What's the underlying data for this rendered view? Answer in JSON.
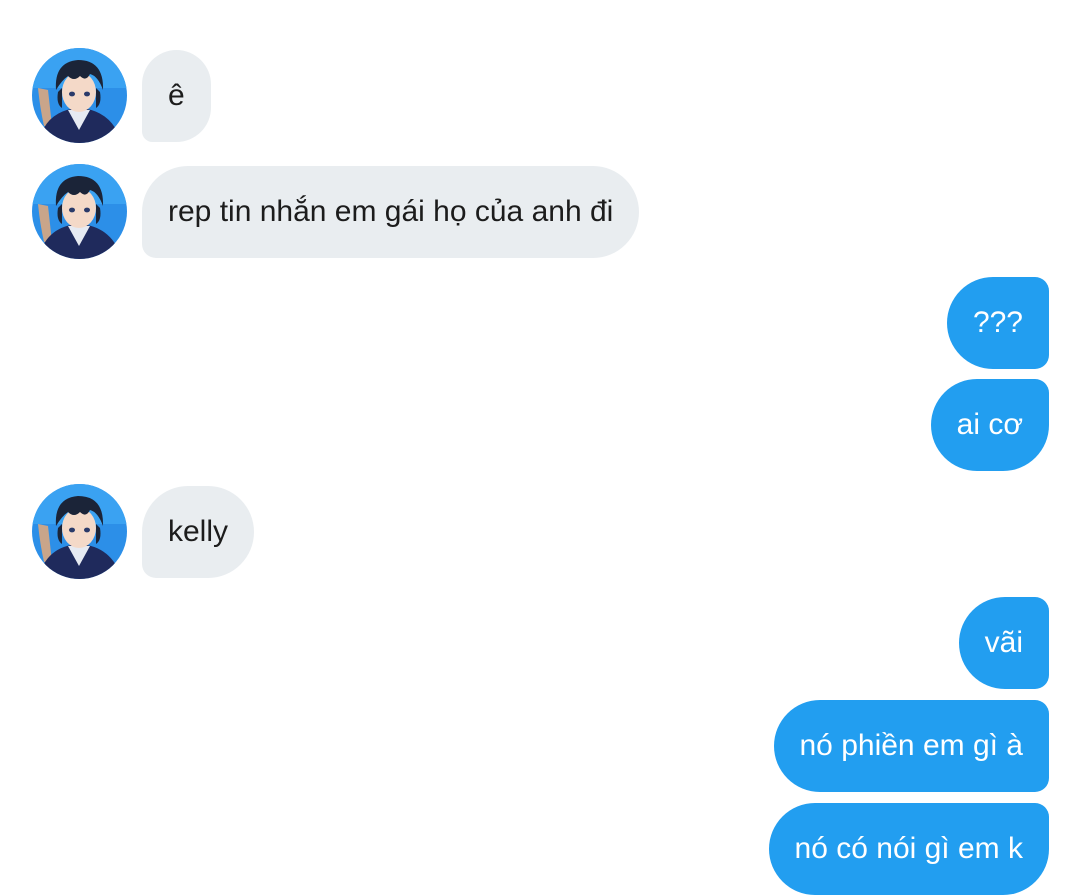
{
  "messages": [
    {
      "side": "in",
      "text": "ê"
    },
    {
      "side": "in",
      "text": "rep tin nhắn em gái họ của anh đi"
    },
    {
      "side": "out",
      "text": "???"
    },
    {
      "side": "out",
      "text": "ai cơ"
    },
    {
      "side": "in",
      "text": "kelly"
    },
    {
      "side": "out",
      "text": "vãi"
    },
    {
      "side": "out",
      "text": "nó phiền em gì à"
    },
    {
      "side": "out",
      "text": "nó có nói gì em k"
    }
  ],
  "colors": {
    "incoming_bubble": "#e9edf0",
    "outgoing_bubble": "#229ef0",
    "incoming_text": "#1c1c1c",
    "outgoing_text": "#ffffff"
  },
  "avatar_icon": "anime-boy-avatar-icon"
}
